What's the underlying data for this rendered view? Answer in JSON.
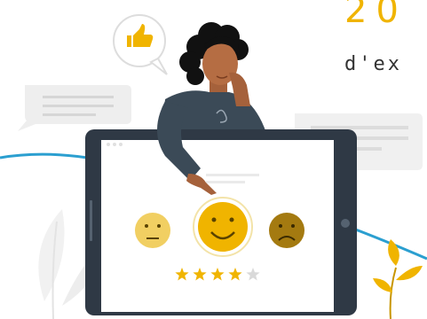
{
  "headline": {
    "text": "20"
  },
  "subline": {
    "text": "d'ex"
  },
  "rating": {
    "stars_filled": 4,
    "stars_total": 5
  },
  "colors": {
    "accent_yellow": "#f0b400",
    "face_light": "#f1cf62",
    "face_dark": "#a47a10",
    "curve_blue": "#2b9fd0",
    "tablet_frame": "#2f3945",
    "shirt": "#3b4a57",
    "skin": "#a5613b",
    "hair": "#111111",
    "star_empty": "#d9d9d9"
  },
  "icons": [
    "thumbs-up-icon",
    "neutral-face-icon",
    "happy-face-icon",
    "sad-face-icon",
    "star-icon",
    "leaf-icon"
  ]
}
